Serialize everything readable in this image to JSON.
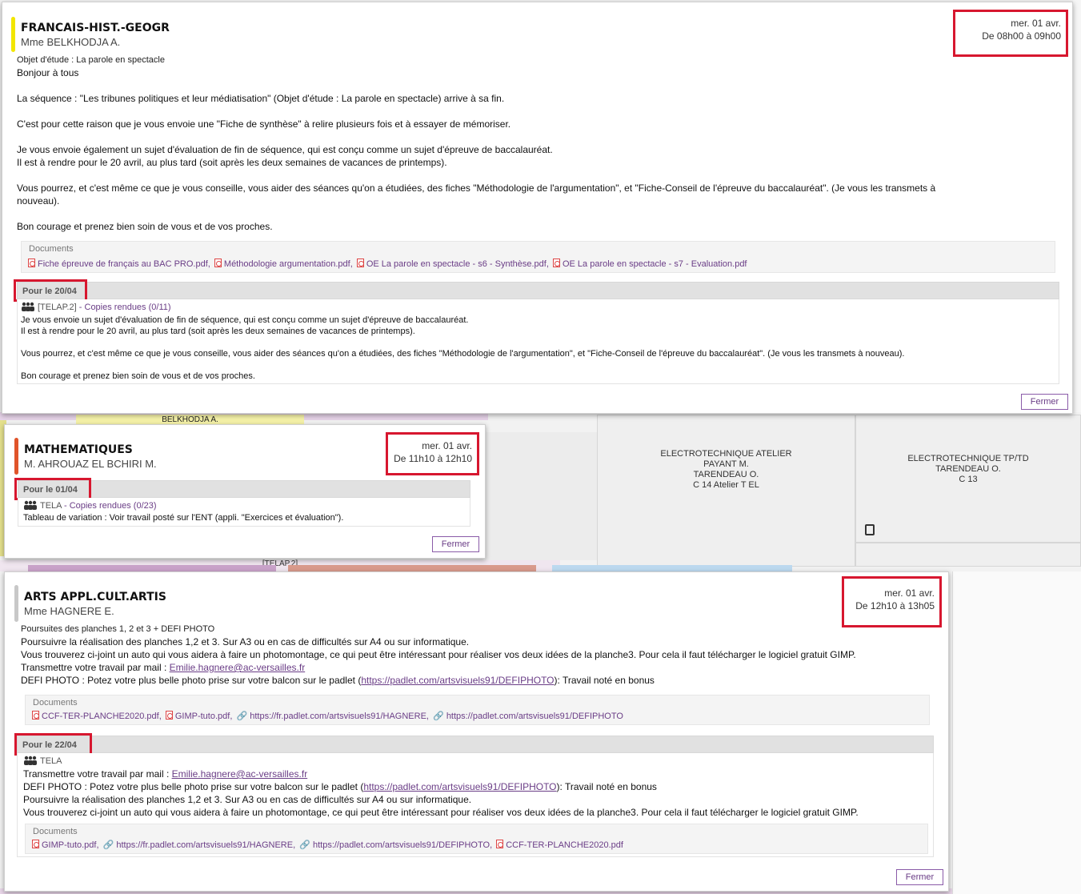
{
  "background": {
    "cells": [
      {
        "lines": [
          "ELECTROTECHNIQUE ATELIER",
          "PAYANT M.",
          "TARENDEAU O.",
          "C 14 Atelier T EL"
        ]
      },
      {
        "lines": [
          "ELECTROTECHNIQUE TP/TD",
          "TARENDEAU O.",
          "C 13"
        ]
      }
    ],
    "partial_labels": {
      "belkhodja": "BELKHODJA A.",
      "arts": "ARTS APPL.CULT.ARTIS",
      "telap": "[TELAP.2]"
    }
  },
  "panels": [
    {
      "subject": "FRANCAIS-HIST.-GEOGR",
      "teacher": "Mme BELKHODJA A.",
      "accent": "#f2e600",
      "date": "mer. 01 avr.",
      "time": "De 08h00 à 09h00",
      "objet": "Objet d'étude : La parole en spectacle",
      "paragraphs": [
        "Bonjour à tous",
        "La séquence : \"Les tribunes politiques et leur médiatisation\" (Objet d'étude : La parole en spectacle) arrive à sa fin.",
        "C'est pour cette raison que je vous envoie une \"Fiche de synthèse\" à relire plusieurs fois et à essayer de mémoriser.",
        "Je vous envoie également un sujet d'évaluation de fin de séquence, qui est conçu comme un sujet d'épreuve de baccalauréat.",
        "Il est à rendre pour le 20 avril, au plus tard (soit après les deux semaines de vacances de printemps).",
        "Vous pourrez, et c'est même ce que je vous conseille, vous aider des séances qu'on a étudiées, des fiches \"Méthodologie de l'argumentation\", et \"Fiche-Conseil de l'épreuve du baccalauréat\". (Je vous les transmets à",
        "nouveau).",
        "Bon courage et prenez bien soin de vous et de vos proches."
      ],
      "documents_label": "Documents",
      "documents": [
        {
          "icon": "pdf-icon",
          "name": "Fiche épreuve de français au BAC PRO.pdf"
        },
        {
          "icon": "pdf-icon",
          "name": "Méthodologie argumentation.pdf"
        },
        {
          "icon": "pdf-icon",
          "name": "OE La parole en spectacle - s6 - Synthèse.pdf"
        },
        {
          "icon": "pdf-icon",
          "name": "OE La parole en spectacle - s7 - Evaluation.pdf"
        }
      ],
      "homework": {
        "due": "Pour le 20/04",
        "group": "[TELAP.2]",
        "copies": "- Copies rendues (0/11)",
        "lines": [
          "Je vous envoie un sujet d'évaluation de fin de séquence, qui est conçu comme un sujet d'épreuve de baccalauréat.",
          "Il est à rendre pour le 20 avril, au plus tard (soit après les deux semaines de vacances de printemps).",
          "Vous pourrez, et c'est même ce que je vous conseille, vous aider des séances qu'on a étudiées, des fiches \"Méthodologie de l'argumentation\", et \"Fiche-Conseil de l'épreuve du baccalauréat\". (Je vous les transmets à nouveau).",
          "Bon courage et prenez bien soin de vous et de vos proches."
        ]
      },
      "close_label": "Fermer"
    },
    {
      "subject": "MATHEMATIQUES",
      "teacher": "M. AHROUAZ EL BCHIRI M.",
      "accent": "#e0542a",
      "date": "mer. 01 avr.",
      "time": "De 11h10 à 12h10",
      "homework": {
        "due": "Pour le 01/04",
        "group": "TELA",
        "copies": "- Copies rendues (0/23)",
        "lines": [
          "Tableau de variation : Voir travail posté sur l'ENT (appli. \"Exercices et évaluation\")."
        ]
      },
      "close_label": "Fermer"
    },
    {
      "subject": "ARTS APPL.CULT.ARTIS",
      "teacher": "Mme HAGNERE E.",
      "accent": "#c8c8c8",
      "date": "mer. 01 avr.",
      "time": "De 12h10 à 13h05",
      "objet": "Poursuites des planches 1, 2 et 3 + DEFI PHOTO",
      "lines": {
        "l1": "Poursuivre la réalisation des planches 1,2 et 3. Sur A3 ou en cas de difficultés sur A4 ou sur informatique.",
        "l2": "Vous trouverez ci-joint un auto qui vous aidera à faire un photomontage, ce qui peut être intéressant pour réaliser vos deux idées de la planche3. Pour cela il faut télécharger le logiciel gratuit GIMP.",
        "l3_prefix": "Transmettre votre travail par mail : ",
        "email": "Emilie.hagnere@ac-versailles.fr",
        "l4_prefix": "DEFI PHOTO : Potez votre plus belle photo prise sur votre balcon sur le padlet (",
        "padlet": "https://padlet.com/artsvisuels91/DEFIPHOTO",
        "l4_suffix": "): Travail noté en bonus"
      },
      "documents_label": "Documents",
      "documents": [
        {
          "icon": "pdf-icon",
          "name": "CCF-TER-PLANCHE2020.pdf"
        },
        {
          "icon": "pdf-icon",
          "name": "GIMP-tuto.pdf"
        },
        {
          "icon": "link-icon",
          "name": "https://fr.padlet.com/artsvisuels91/HAGNERE"
        },
        {
          "icon": "link-icon",
          "name": "https://padlet.com/artsvisuels91/DEFIPHOTO"
        }
      ],
      "homework": {
        "due": "Pour le 22/04",
        "group": "TELA",
        "documents_label": "Documents",
        "documents": [
          {
            "icon": "pdf-icon",
            "name": "GIMP-tuto.pdf"
          },
          {
            "icon": "link-icon",
            "name": "https://fr.padlet.com/artsvisuels91/HAGNERE"
          },
          {
            "icon": "link-icon",
            "name": "https://padlet.com/artsvisuels91/DEFIPHOTO"
          },
          {
            "icon": "pdf-icon",
            "name": "CCF-TER-PLANCHE2020.pdf"
          }
        ]
      },
      "close_label": "Fermer"
    }
  ]
}
